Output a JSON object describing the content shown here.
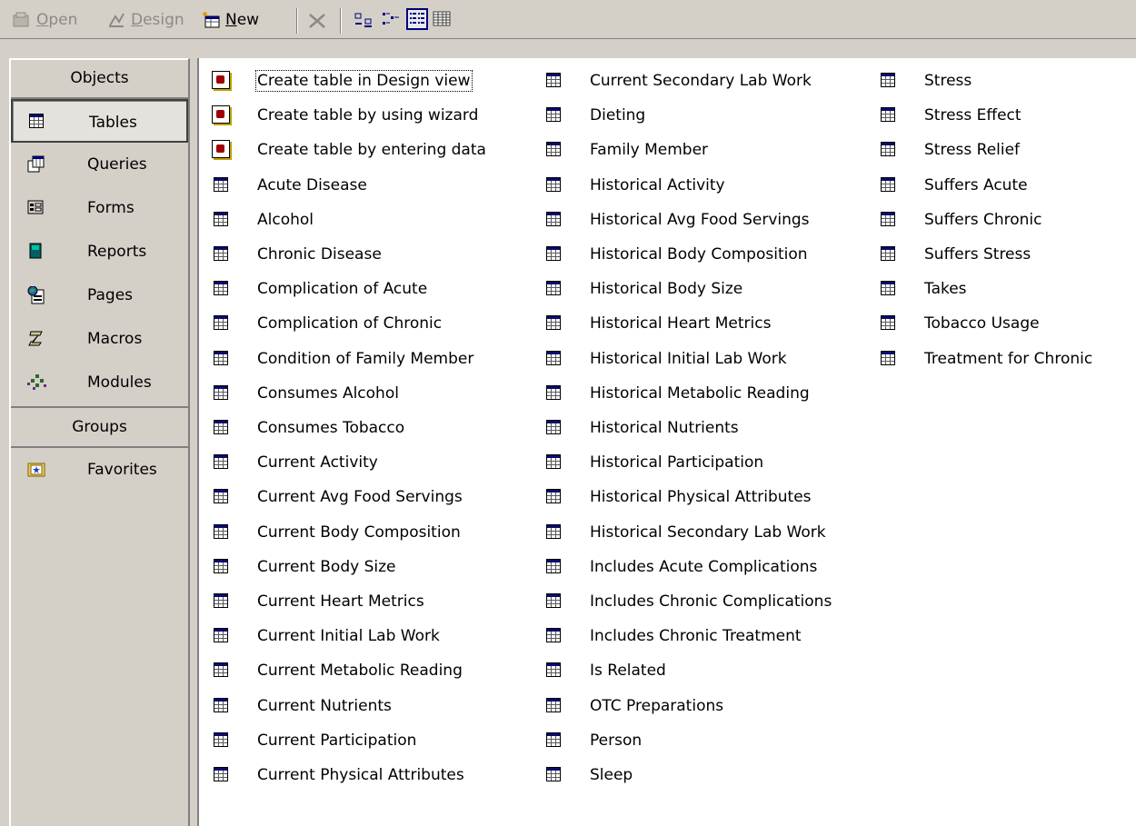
{
  "toolbar": {
    "open": {
      "prefix": "",
      "accel": "O",
      "rest": "pen"
    },
    "design": {
      "accel": "D",
      "rest": "esign"
    },
    "new": {
      "accel": "N",
      "rest": "ew"
    }
  },
  "sidebar": {
    "objects_header": "Objects",
    "items": [
      {
        "label": "Tables",
        "icon": "table-icon"
      },
      {
        "label": "Queries",
        "icon": "query-icon"
      },
      {
        "label": "Forms",
        "icon": "form-icon"
      },
      {
        "label": "Reports",
        "icon": "report-icon"
      },
      {
        "label": "Pages",
        "icon": "page-icon"
      },
      {
        "label": "Macros",
        "icon": "macro-icon"
      },
      {
        "label": "Modules",
        "icon": "module-icon"
      }
    ],
    "groups_header": "Groups",
    "groups": [
      {
        "label": "Favorites",
        "icon": "favorites-folder-icon"
      }
    ]
  },
  "list": {
    "shortcuts": [
      "Create table in Design view",
      "Create table by using wizard",
      "Create table by entering data"
    ],
    "tables": [
      "Acute Disease",
      "Alcohol",
      "Chronic Disease",
      "Complication of Acute",
      "Complication of Chronic",
      "Condition of Family Member",
      "Consumes Alcohol",
      "Consumes Tobacco",
      "Current Activity",
      "Current Avg Food Servings",
      "Current Body Composition",
      "Current Body Size",
      "Current Heart Metrics",
      "Current Initial Lab Work",
      "Current Metabolic Reading",
      "Current Nutrients",
      "Current Participation",
      "Current Physical Attributes",
      "Current Secondary Lab Work",
      "Dieting",
      "Family Member",
      "Historical Activity",
      "Historical Avg Food Servings",
      "Historical Body Composition",
      "Historical Body Size",
      "Historical Heart Metrics",
      "Historical Initial Lab Work",
      "Historical Metabolic Reading",
      "Historical Nutrients",
      "Historical Participation",
      "Historical Physical Attributes",
      "Historical Secondary Lab Work",
      "Includes Acute Complications",
      "Includes Chronic Complications",
      "Includes Chronic Treatment",
      "Is Related",
      "OTC Preparations",
      "Person",
      "Sleep",
      "Stress",
      "Stress Effect",
      "Stress Relief",
      "Suffers Acute",
      "Suffers Chronic",
      "Suffers Stress",
      "Takes",
      "Tobacco Usage",
      "Treatment for Chronic"
    ]
  }
}
